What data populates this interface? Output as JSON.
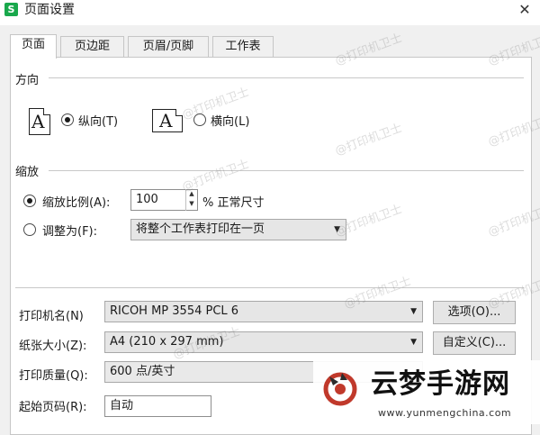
{
  "window": {
    "title": "页面设置",
    "app_icon": "S"
  },
  "tabs": [
    {
      "label": "页面",
      "active": true
    },
    {
      "label": "页边距",
      "active": false
    },
    {
      "label": "页眉/页脚",
      "active": false
    },
    {
      "label": "工作表",
      "active": false
    }
  ],
  "orientation": {
    "section_label": "方向",
    "glyph": "A",
    "portrait_label": "纵向(T)",
    "landscape_label": "横向(L)",
    "selected": "portrait"
  },
  "scaling": {
    "section_label": "缩放",
    "adjust_label": "缩放比例(A):",
    "adjust_value": "100",
    "percent_suffix": "% 正常尺寸",
    "fit_label": "调整为(F):",
    "fit_option": "将整个工作表打印在一页",
    "selected": "adjust"
  },
  "printer": {
    "name_label": "打印机名(N)",
    "name_value": "RICOH MP 3554 PCL 6",
    "options_button": "选项(O)...",
    "paper_label": "纸张大小(Z):",
    "paper_value": "A4 (210 x 297 mm)",
    "custom_button": "自定义(C)...",
    "quality_label": "打印质量(Q):",
    "quality_value": "600 点/英寸",
    "first_page_label": "起始页码(R):",
    "first_page_value": "自动"
  },
  "watermarks": [
    "@打印机卫士",
    "@打印机卫士",
    "@打印机卫士",
    "@打印机卫士",
    "@打印机卫士",
    "@打印机卫士",
    "@打印机卫士",
    "@打印机卫士",
    "@打印机卫士",
    "@打印机卫士",
    "@打印机卫士"
  ],
  "brand": {
    "name": "云梦手游网",
    "url": "www.yunmengchina.com"
  },
  "colors": {
    "app_icon": "#19a84c",
    "logo_accent": "#c0392b"
  }
}
